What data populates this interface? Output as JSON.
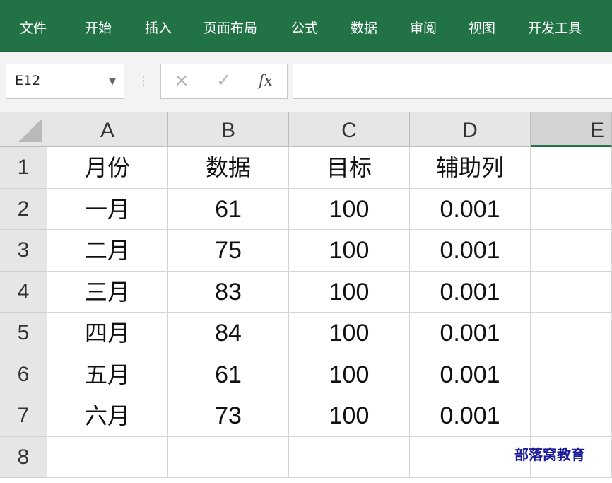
{
  "ribbon": {
    "tabs": [
      "文件",
      "开始",
      "插入",
      "页面布局",
      "公式",
      "数据",
      "审阅",
      "视图",
      "开发工具"
    ],
    "color": "#217346"
  },
  "formula_bar": {
    "name_box": "E12",
    "cancel_icon": "×",
    "enter_icon": "✓",
    "fx_icon": "fx",
    "formula_value": ""
  },
  "sheet": {
    "columns": [
      "A",
      "B",
      "C",
      "D",
      "E"
    ],
    "selected_column": "E",
    "rows": [
      {
        "num": "1",
        "cells": [
          "月份",
          "数据",
          "目标",
          "辅助列",
          ""
        ]
      },
      {
        "num": "2",
        "cells": [
          "一月",
          "61",
          "100",
          "0.001",
          ""
        ]
      },
      {
        "num": "3",
        "cells": [
          "二月",
          "75",
          "100",
          "0.001",
          ""
        ]
      },
      {
        "num": "4",
        "cells": [
          "三月",
          "83",
          "100",
          "0.001",
          ""
        ]
      },
      {
        "num": "5",
        "cells": [
          "四月",
          "84",
          "100",
          "0.001",
          ""
        ]
      },
      {
        "num": "6",
        "cells": [
          "五月",
          "61",
          "100",
          "0.001",
          ""
        ]
      },
      {
        "num": "7",
        "cells": [
          "六月",
          "73",
          "100",
          "0.001",
          ""
        ]
      },
      {
        "num": "8",
        "cells": [
          "",
          "",
          "",
          "",
          ""
        ]
      }
    ]
  },
  "watermark": "部落窝教育"
}
